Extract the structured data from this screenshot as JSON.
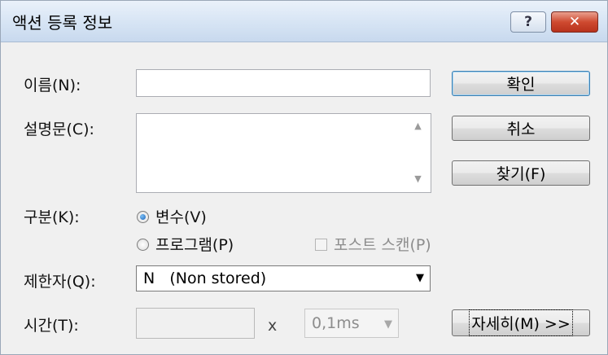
{
  "window": {
    "title": "액션 등록 정보",
    "help_glyph": "?",
    "close_glyph": "✕"
  },
  "fields": {
    "name_label": "이름(N):",
    "name_value": "",
    "description_label": "설명문(C):",
    "description_value": "",
    "type_label": "구분(K):",
    "radio_variable_label": "변수(V)",
    "radio_program_label": "프로그램(P)",
    "post_scan_label": "포스트 스캔(P)",
    "qualifier_label": "제한자(Q):",
    "qualifier_value": "N   (Non stored)",
    "time_label": "시간(T):",
    "time_value": "",
    "multiply_sign": "x",
    "time_unit_value": "0,1ms"
  },
  "state": {
    "type_selected": "variable",
    "post_scan_checked": false,
    "post_scan_enabled": false,
    "time_enabled": false
  },
  "buttons": {
    "ok_label": "확인",
    "cancel_label": "취소",
    "browse_label": "찾기(F)",
    "details_label": "자세히(M) >>"
  },
  "icons": {
    "scroll_up": "▲",
    "scroll_down": "▼",
    "dropdown": "▼"
  },
  "colors": {
    "window_bg": "#f0f0f0",
    "titlebar": "#d6e4f4",
    "close_button": "#cf4a30",
    "radio_selected": "#1c63b8"
  }
}
